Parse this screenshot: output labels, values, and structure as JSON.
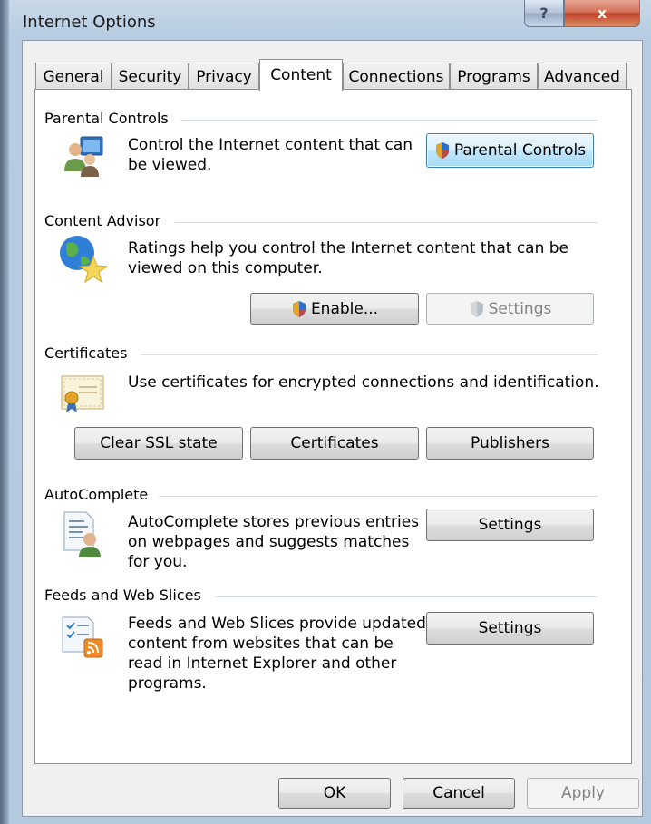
{
  "window": {
    "title": "Internet Options",
    "help_glyph": "?",
    "close_glyph": "x"
  },
  "tabs": [
    {
      "label": "General"
    },
    {
      "label": "Security"
    },
    {
      "label": "Privacy"
    },
    {
      "label": "Content"
    },
    {
      "label": "Connections"
    },
    {
      "label": "Programs"
    },
    {
      "label": "Advanced"
    }
  ],
  "active_tab": "Content",
  "parental_controls": {
    "title": "Parental Controls",
    "description_line1": "Control the Internet content that can",
    "description_line2": "be viewed.",
    "button": "Parental Controls",
    "icon": "parental-controls-icon"
  },
  "content_advisor": {
    "title": "Content Advisor",
    "description_line1": "Ratings help you control the Internet content that can be",
    "description_line2": "viewed on this computer.",
    "enable_button": "Enable...",
    "settings_button": "Settings",
    "icon": "globe-star-icon"
  },
  "certificates": {
    "title": "Certificates",
    "description": "Use certificates for encrypted connections and identification.",
    "clear_ssl_button": "Clear SSL state",
    "certificates_button": "Certificates",
    "publishers_button": "Publishers",
    "icon": "certificate-icon"
  },
  "autocomplete": {
    "title": "AutoComplete",
    "description_line1": "AutoComplete stores previous entries",
    "description_line2": "on webpages and suggests matches",
    "description_line3": "for you.",
    "settings_button": "Settings",
    "icon": "autocomplete-icon"
  },
  "feeds": {
    "title": "Feeds and Web Slices",
    "description_line1": "Feeds and Web Slices provide updated",
    "description_line2": "content from websites that can be",
    "description_line3": "read in Internet Explorer and other",
    "description_line4": "programs.",
    "settings_button": "Settings",
    "icon": "feeds-icon"
  },
  "footer": {
    "ok": "OK",
    "cancel": "Cancel",
    "apply": "Apply"
  },
  "colors": {
    "accent": "#3c7fb1",
    "group_line": "#d5dfe5",
    "close_red": "#c0442a"
  }
}
